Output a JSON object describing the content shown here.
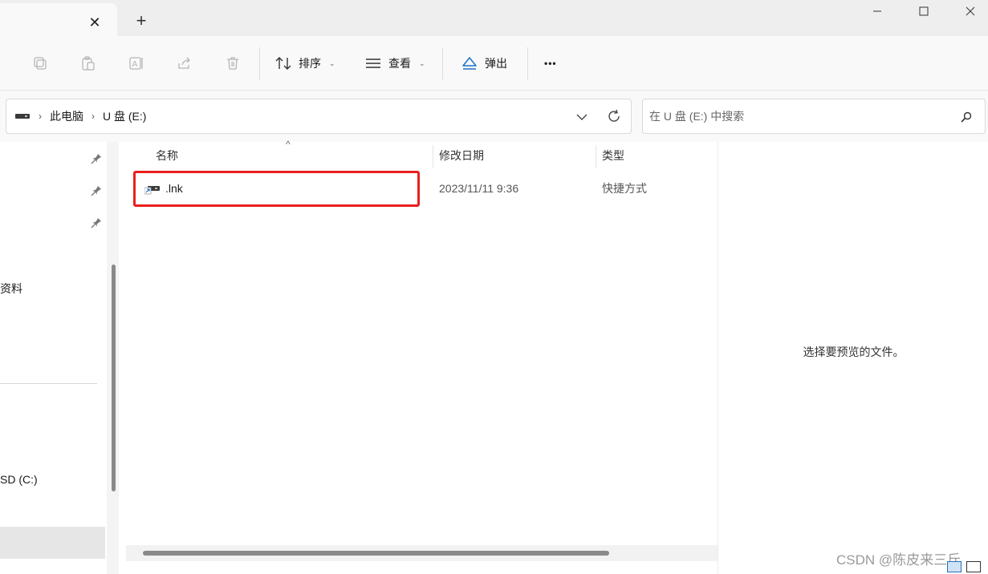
{
  "window": {
    "tab": {
      "close_glyph": "✕"
    },
    "new_tab_glyph": "+"
  },
  "toolbar": {
    "sort_label": "排序",
    "view_label": "查看",
    "eject_label": "弹出",
    "more_glyph": "•••"
  },
  "address": {
    "crumbs": [
      "此电脑",
      "U 盘 (E:)"
    ]
  },
  "search": {
    "placeholder": "在 U 盘 (E:) 中搜索"
  },
  "nav": {
    "items": [
      "资料",
      "SD (C:)"
    ]
  },
  "filelist": {
    "columns": {
      "name": "名称",
      "modified": "修改日期",
      "type": "类型"
    },
    "rows": [
      {
        "name": ".lnk",
        "modified": "2023/11/11 9:36",
        "type": "快捷方式"
      }
    ]
  },
  "preview": {
    "message": "选择要预览的文件。"
  },
  "watermark": "CSDN @陈皮来三斤",
  "colors": {
    "highlight": "#e8201e",
    "accent": "#1a73c6"
  }
}
